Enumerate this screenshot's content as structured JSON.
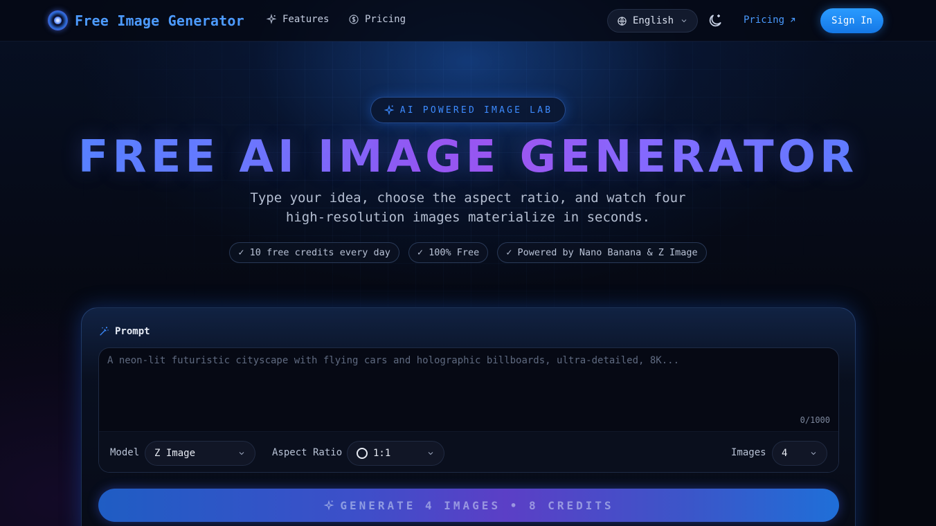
{
  "brand": {
    "name": "Free Image Generator"
  },
  "nav": {
    "features_label": "Features",
    "pricing_label": "Pricing",
    "language": "English",
    "pricing_link": "Pricing",
    "signin_label": "Sign In"
  },
  "hero": {
    "pill_label": "AI POWERED IMAGE LAB",
    "title": "FREE AI IMAGE GENERATOR",
    "subtitle_line1": "Type your idea, choose the aspect ratio, and watch four",
    "subtitle_line2": "high-resolution images materialize in seconds.",
    "badges": [
      "✓ 10 free credits every day",
      "✓ 100% Free",
      "✓ Powered by Nano Banana & Z Image"
    ]
  },
  "generator": {
    "prompt_label": "Prompt",
    "prompt_placeholder": "A neon-lit futuristic cityscape with flying cars and holographic billboards, ultra-detailed, 8K...",
    "prompt_value": "",
    "char_count": "0/1000",
    "model_label": "Model",
    "model_value": "Z Image",
    "aspect_label": "Aspect Ratio",
    "aspect_value": "1:1",
    "images_label": "Images",
    "images_value": "4",
    "generate_label": "GENERATE 4 IMAGES • 8 CREDITS"
  },
  "colors": {
    "accent": "#3d8bff",
    "signin_bg": "#1f8bf5",
    "title_gradient_start": "#4f86ff",
    "title_gradient_mid": "#a255f0",
    "background": "#05070f"
  },
  "icons": {
    "logo": "swirl-logo-icon",
    "features": "sparkle-icon",
    "pricing": "dollar-circle-icon",
    "language": "globe-icon",
    "theme": "moon-sparkle-icon",
    "external": "arrow-up-right-icon",
    "prompt": "magic-wand-icon",
    "generate": "sparkle-icon"
  }
}
